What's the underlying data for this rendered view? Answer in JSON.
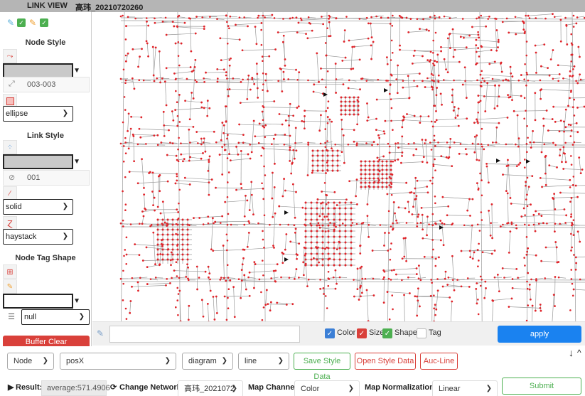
{
  "title": {
    "view": "LINK VIEW",
    "file": "高玮_20210720260"
  },
  "sidebar": {
    "node_style_title": "Node Style",
    "node_size": "003-003",
    "node_shape": "ellipse",
    "link_style_title": "Link Style",
    "link_width": "001",
    "link_line": "solid",
    "link_curve": "haystack",
    "node_tag_title": "Node Tag Shape",
    "tag_value": "null",
    "red_button": "Buffer Clear"
  },
  "strip": {
    "apply": "apply",
    "checks": [
      {
        "label": "Color",
        "checked": true,
        "color": "#3b7fd6"
      },
      {
        "label": "Size",
        "checked": true,
        "color": "#d9403a"
      },
      {
        "label": "Shape",
        "checked": true,
        "color": "#4caf50"
      },
      {
        "label": "Tag",
        "checked": false,
        "color": "#ffffff"
      }
    ]
  },
  "controls": {
    "element_type": "Node",
    "attribute": "posX",
    "view_type": "diagram",
    "chart_kind": "line",
    "save_style": "Save Style Data",
    "open_style": "Open Style Data",
    "auc_line": "Auc-Line",
    "result_label": "Result:",
    "result_value": "average:571.4906",
    "change_network_label": "Change Network",
    "network_value": "高玮_2021072",
    "map_channel_label": "Map Channel",
    "map_channel_value": "Color",
    "map_norm_label": "Map Normalization",
    "map_norm_value": "Linear",
    "submit": "Submit"
  },
  "colors": {
    "node": "#e0242a",
    "link": "#9a9a9a",
    "accent": "#1a82f0"
  }
}
